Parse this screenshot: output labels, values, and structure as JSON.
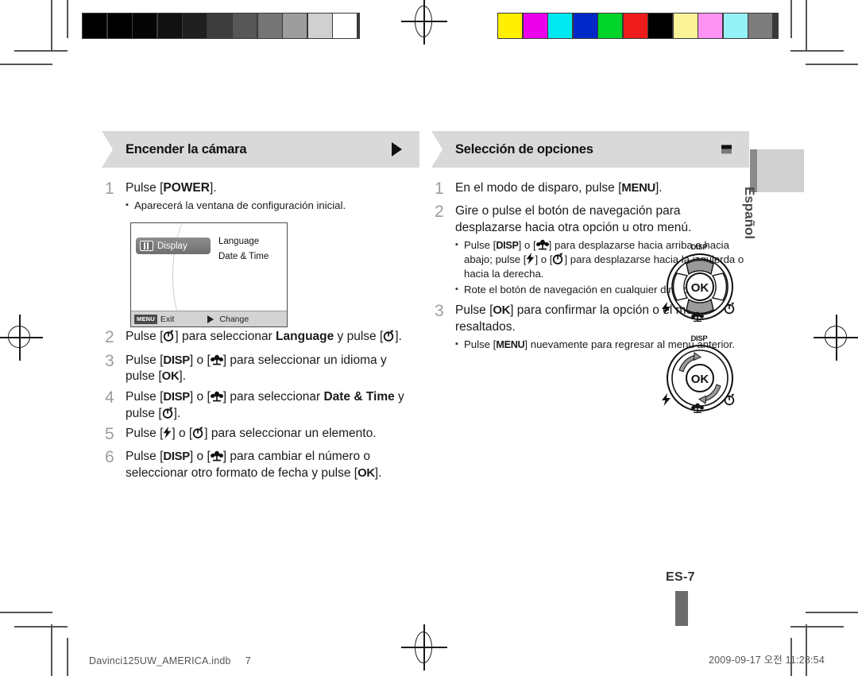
{
  "document": {
    "page_label": "ES-7",
    "language_tab": "Español",
    "footer_left_file": "Davinci125UW_AMERICA.indb",
    "footer_left_page": "7",
    "footer_right_datetime": "2009-09-17   오전 11:28:54"
  },
  "calibration": {
    "grayscale": [
      "#000000",
      "#000000",
      "#050505",
      "#111111",
      "#1f1f1f",
      "#3d3d3d",
      "#575757",
      "#757575",
      "#9d9d9d",
      "#d0d0d0",
      "#ffffff"
    ],
    "color": [
      "#ffef00",
      "#ec00ec",
      "#00e8f0",
      "#0027c8",
      "#00d52b",
      "#ee1c1c",
      "#000000",
      "#fbf398",
      "#ff93f3",
      "#95f2f7",
      "#7d7d7d"
    ]
  },
  "left_column": {
    "header": {
      "title": "Encender la cámara",
      "marker": "triangle-right-icon"
    },
    "steps": [
      {
        "num": "1",
        "parts": [
          {
            "t": "Pulse ["
          },
          {
            "t": "POWER",
            "bold": true
          },
          {
            "t": "]."
          }
        ],
        "bullets": [
          {
            "parts": [
              {
                "t": "Aparecerá la ventana de configuración inicial."
              }
            ]
          }
        ]
      },
      {
        "num": "2",
        "parts": [
          {
            "t": "Pulse ["
          },
          {
            "icon": "timer-key-icon"
          },
          {
            "t": "] para seleccionar "
          },
          {
            "t": "Language",
            "bold": true
          },
          {
            "t": " y pulse ["
          },
          {
            "icon": "timer-key-icon"
          },
          {
            "t": "]."
          }
        ]
      },
      {
        "num": "3",
        "parts": [
          {
            "t": "Pulse ["
          },
          {
            "t": "DISP",
            "keytxt": true
          },
          {
            "t": "] o ["
          },
          {
            "icon": "macro-key-icon"
          },
          {
            "t": "] para seleccionar un idioma y pulse ["
          },
          {
            "t": "OK",
            "keytxt": true
          },
          {
            "t": "]."
          }
        ]
      },
      {
        "num": "4",
        "parts": [
          {
            "t": "Pulse ["
          },
          {
            "t": "DISP",
            "keytxt": true
          },
          {
            "t": "] o ["
          },
          {
            "icon": "macro-key-icon"
          },
          {
            "t": "] para seleccionar "
          },
          {
            "t": "Date & Time",
            "bold": true
          },
          {
            "t": " y pulse ["
          },
          {
            "icon": "timer-key-icon"
          },
          {
            "t": "]."
          }
        ]
      },
      {
        "num": "5",
        "parts": [
          {
            "t": "Pulse ["
          },
          {
            "icon": "flash-key-icon"
          },
          {
            "t": "] o ["
          },
          {
            "icon": "timer-key-icon"
          },
          {
            "t": "] para seleccionar un elemento."
          }
        ]
      },
      {
        "num": "6",
        "parts": [
          {
            "t": "Pulse ["
          },
          {
            "t": "DISP",
            "keytxt": true
          },
          {
            "t": "] o ["
          },
          {
            "icon": "macro-key-icon"
          },
          {
            "t": "] para cambiar el número o seleccionar otro formato de fecha y pulse ["
          },
          {
            "t": "OK",
            "keytxt": true
          },
          {
            "t": "]."
          }
        ]
      }
    ],
    "lcd_screen": {
      "tab_label": "Display",
      "options": [
        "Language",
        "Date & Time"
      ],
      "bottom_bar": {
        "menu_key": "MENU",
        "exit_label": "Exit",
        "change_label": "Change"
      }
    }
  },
  "right_column": {
    "header": {
      "title": "Selección de opciones",
      "marker": "square-marker-icon"
    },
    "steps": [
      {
        "num": "1",
        "parts": [
          {
            "t": "En el modo de disparo, pulse ["
          },
          {
            "t": "MENU",
            "keytxt": true
          },
          {
            "t": "]."
          }
        ]
      },
      {
        "num": "2",
        "parts": [
          {
            "t": "Gire o pulse el botón de navegación para desplazarse hacia otra opción u otro menú."
          }
        ],
        "bullets": [
          {
            "parts": [
              {
                "t": "Pulse ["
              },
              {
                "t": "DISP",
                "keytxt": true
              },
              {
                "t": "] o ["
              },
              {
                "icon": "macro-key-icon"
              },
              {
                "t": "] para desplazarse hacia arriba o hacia abajo; pulse ["
              },
              {
                "icon": "flash-key-icon"
              },
              {
                "t": "] o ["
              },
              {
                "icon": "timer-key-icon"
              },
              {
                "t": "] para desplazarse hacia la izquierda o hacia la derecha."
              }
            ]
          },
          {
            "parts": [
              {
                "t": "Rote el botón de navegación en cualquier dirección."
              }
            ]
          }
        ]
      },
      {
        "num": "3",
        "parts": [
          {
            "t": "Pulse ["
          },
          {
            "t": "OK",
            "keytxt": true
          },
          {
            "t": "] para confirmar la opción o el menú resaltados."
          }
        ],
        "bullets": [
          {
            "parts": [
              {
                "t": "Pulse ["
              },
              {
                "t": "MENU",
                "keytxt": true
              },
              {
                "t": "] nuevamente para regresar al menú anterior."
              }
            ]
          }
        ]
      }
    ],
    "dials": [
      {
        "name": "dpad-press-dial",
        "top_label": "DISP",
        "center_label": "OK",
        "bottom_left_icon": "flash-icon",
        "bottom_right_icon": "timer-icon",
        "bottom_icon": "macro-icon",
        "mode": "press"
      },
      {
        "name": "jog-rotate-dial",
        "top_label": "DISP",
        "center_label": "OK",
        "bottom_left_icon": "flash-icon",
        "bottom_right_icon": "timer-icon",
        "bottom_icon": "macro-icon",
        "mode": "rotate"
      }
    ]
  }
}
